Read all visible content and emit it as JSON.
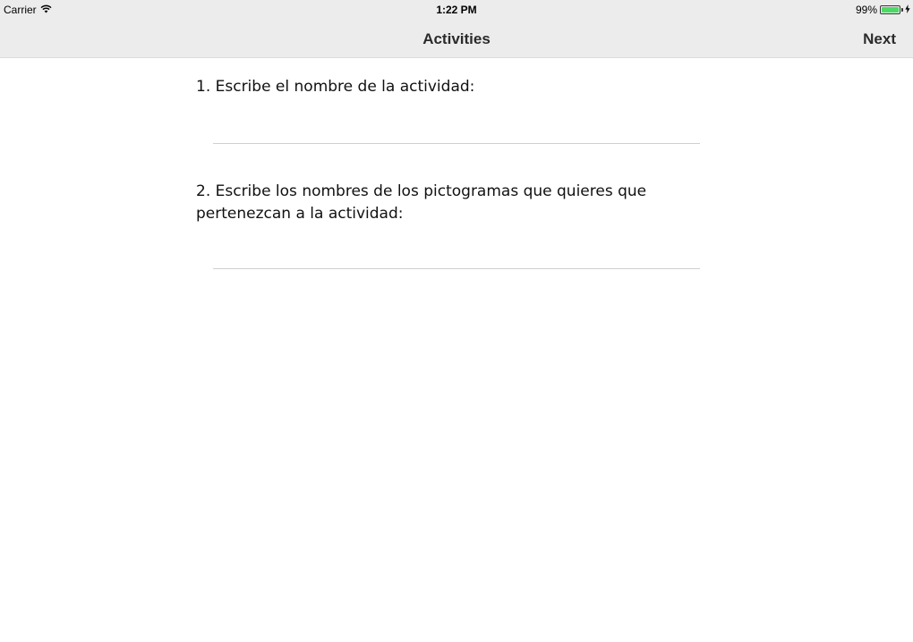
{
  "status_bar": {
    "carrier": "Carrier",
    "wifi_icon": "wifi-icon",
    "time": "1:22 PM",
    "battery_percent": "99%",
    "battery_level": 0.99,
    "battery_color": "#4cd964",
    "charging_icon": "bolt-icon"
  },
  "nav": {
    "title": "Activities",
    "next_label": "Next"
  },
  "form": {
    "question_1": "1. Escribe el nombre de la actividad:",
    "answer_1_value": "",
    "question_2": "2. Escribe los nombres de los pictogramas que quieres que pertenezcan a la actividad:",
    "answer_2_value": ""
  }
}
